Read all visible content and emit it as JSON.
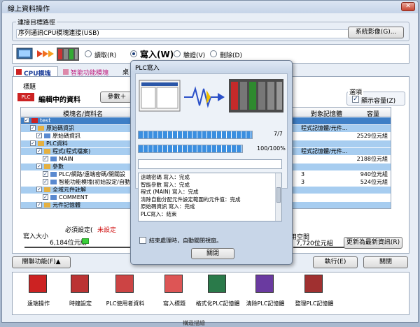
{
  "window": {
    "title": "線上資料操作",
    "close": "✕"
  },
  "connection": {
    "legend": "連接目標路徑",
    "path": "序列通訊CPU模塊連接(USB)",
    "system_image_btn": "系統影像(G)..."
  },
  "operations": [
    {
      "label": "讀取(R)",
      "selected": false
    },
    {
      "label": "寫入(W)",
      "selected": true
    },
    {
      "label": "驗證(V)",
      "selected": false
    },
    {
      "label": "刪除(D)",
      "selected": false
    }
  ],
  "tabs": [
    "CPU模塊",
    "智能功能模塊",
    "桌"
  ],
  "title_label": "標題",
  "editing_label": "編輯中的資料",
  "params_btn": "參數＋",
  "options": {
    "legend": "選項",
    "show_capacity": "顯示容量(Z)",
    "show_capacity_checked": true
  },
  "table": {
    "headers": [
      "模塊名/資料名",
      "對象記憶體",
      "容量"
    ],
    "rows": [
      {
        "text": "test",
        "indent": 0,
        "style": "dark",
        "mem": "",
        "cap": ""
      },
      {
        "text": "原始碼資訊",
        "indent": 1,
        "style": "blue",
        "mem": "程式記憶體/元件...",
        "cap": ""
      },
      {
        "text": "原始碼資訊",
        "indent": 2,
        "style": "",
        "mem": "",
        "cap": "2529位元組"
      },
      {
        "text": "PLC資料",
        "indent": 1,
        "style": "blue",
        "mem": "",
        "cap": ""
      },
      {
        "text": "程式(程式檔案)",
        "indent": 2,
        "style": "blue",
        "mem": "程式記憶體/元件...",
        "cap": ""
      },
      {
        "text": "MAIN",
        "indent": 3,
        "style": "",
        "mem": "",
        "cap": "2188位元組"
      },
      {
        "text": "參數",
        "indent": 2,
        "style": "blue",
        "mem": "",
        "cap": ""
      },
      {
        "text": "PLC/網路/遠端密碼/開關設",
        "indent": 3,
        "style": "",
        "mem": "3",
        "cap": "940位元組"
      },
      {
        "text": "智能功能模塊(初始設定/自動",
        "indent": 3,
        "style": "",
        "mem": "3",
        "cap": "524位元組"
      },
      {
        "text": "全域元件註解",
        "indent": 2,
        "style": "blue",
        "mem": "",
        "cap": ""
      },
      {
        "text": "COMMENT",
        "indent": 3,
        "style": "",
        "mem": "",
        "cap": ""
      },
      {
        "text": "元件記憶體",
        "indent": 2,
        "style": "blue",
        "mem": "",
        "cap": ""
      }
    ]
  },
  "required_label": "必須設定(",
  "not_set_label": "未設定",
  "write_size": {
    "label": "寫入大小",
    "value": "6,184位元組"
  },
  "free_space": {
    "label": "用空間",
    "value": "7,720位元組"
  },
  "refresh_btn": "更新為最新資訊(R)",
  "related_btn": "關聯功能(F)▲",
  "execute_btn": "執行(E)",
  "close_btn": "關閉",
  "bottom_items": [
    "遠端操作",
    "時鐘設定",
    "PLC使用者資料",
    "寫入標題",
    "格式化PLC記憶體",
    "清除PLC記憶體",
    "整理PLC記憶體"
  ],
  "status_text": "構造描繪",
  "dialog": {
    "title": "PLC寫入",
    "progress1": {
      "fraction": 1.0,
      "text": "7/7"
    },
    "progress2": {
      "fraction": 1.0,
      "text": "100/100%"
    },
    "log": [
      "遠端密碼 寫入：完成",
      "智能參數 寫入：完成",
      "程式 (MAIN) 寫入：完成",
      "清除自動分配元件設定範圍的元件值：完成",
      "原始碼資訊 寫入：完成",
      "PLC寫入：結束"
    ],
    "close_on_finish": "結束處理時，自動關閉視窗。",
    "close_btn": "關閉"
  }
}
